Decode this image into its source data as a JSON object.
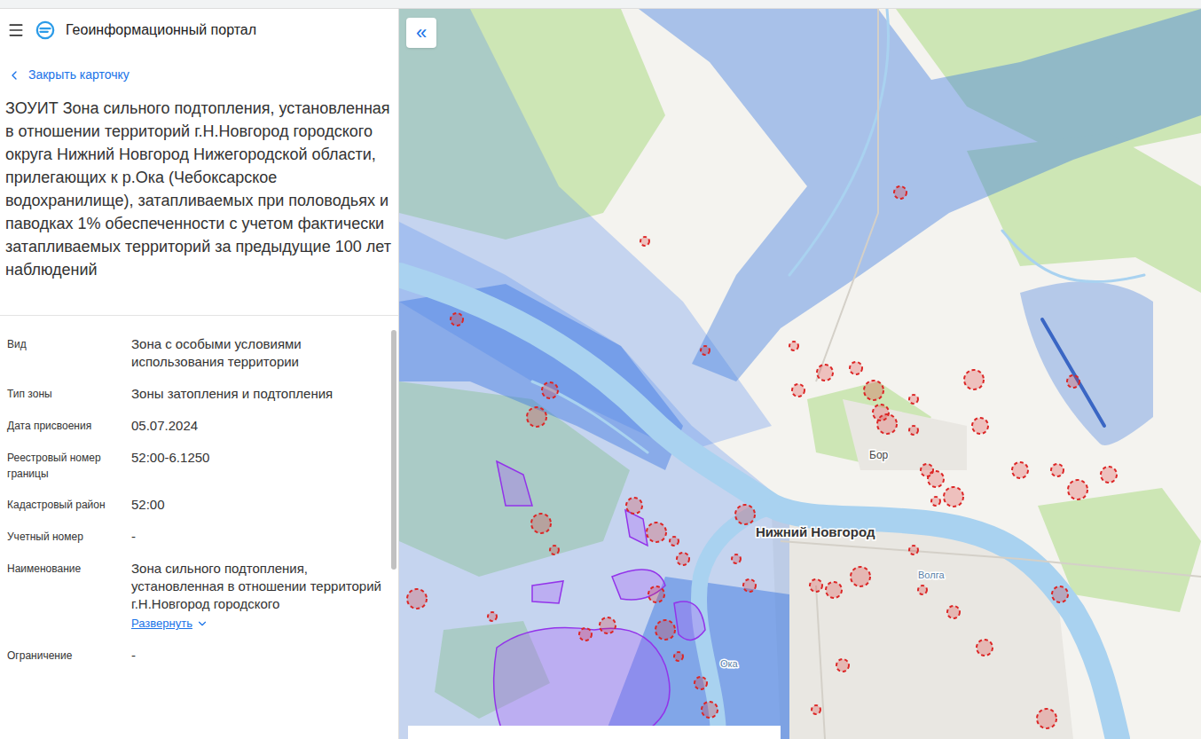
{
  "header": {
    "title": "Геоинформационный портал"
  },
  "card": {
    "back": "Закрыть карточку",
    "title": "ЗОУИТ Зона сильного подтопления, установленная в отношении территорий г.Н.Новгород городского округа Нижний Новгород Нижегородской области, прилегающих к р.Ока (Чебоксарское водохранилище), затапливаемых при половодьях и паводках 1% обеспеченности с учетом фактически затапливаемых территорий за предыдущие 100 лет наблюдений",
    "attributes": [
      {
        "label": "Вид",
        "value": "Зона с особыми условиями использования территории"
      },
      {
        "label": "Тип зоны",
        "value": "Зоны затопления и подтопления"
      },
      {
        "label": "Дата присвоения",
        "value": "05.07.2024"
      },
      {
        "label": "Реестровый номер границы",
        "value": "52:00-6.1250"
      },
      {
        "label": "Кадастровый район",
        "value": "52:00"
      },
      {
        "label": "Учетный номер",
        "value": "-"
      },
      {
        "label": "Наименование",
        "value": "Зона сильного подтопления, установленная в отношении территорий г.Н.Новгород городского",
        "expand": "Развернуть"
      },
      {
        "label": "Ограничение",
        "value": "-"
      }
    ]
  },
  "map": {
    "collapse": "«",
    "labels": [
      {
        "text": "Бор"
      },
      {
        "text": "Нижний Новгород"
      },
      {
        "text": "Волга"
      },
      {
        "text": "Ока"
      }
    ]
  }
}
